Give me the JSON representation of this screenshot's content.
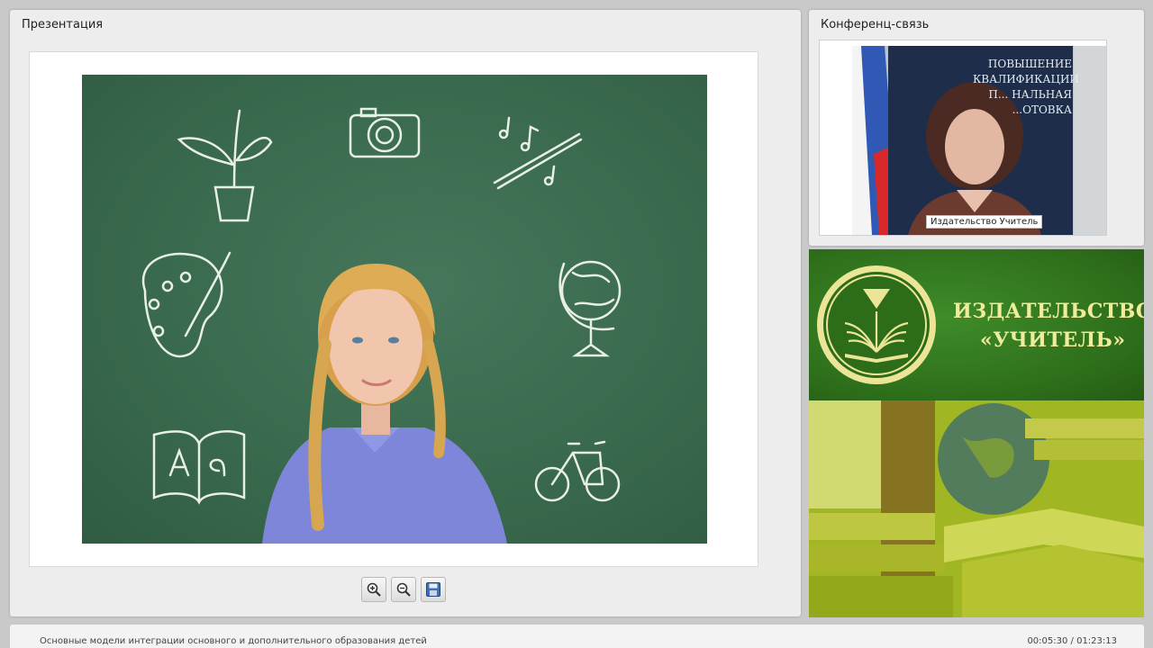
{
  "presentation": {
    "title": "Презентация"
  },
  "toolbar": [
    {
      "name": "zoom-in",
      "icon": "zoom-in-icon"
    },
    {
      "name": "zoom-out",
      "icon": "zoom-out-icon"
    },
    {
      "name": "save",
      "icon": "save-icon"
    }
  ],
  "conference": {
    "title": "Конференц-связь",
    "speaker": "Издательство Учитель"
  },
  "video_backdrop": {
    "line1": "ПОВЫШЕНИЕ",
    "line2": "КВАЛИФИКАЦИИ",
    "line3": "П... НАЛЬНАЯ",
    "line4": "...ОТОВКА"
  },
  "brand": {
    "line1": "ИЗДАТЕЛЬСТВО",
    "line2": "«УЧИТЕЛЬ»"
  },
  "footer": {
    "title": "Основные модели интеграции  основного и дополнительного образования детей",
    "time": "00:05:30 / 01:23:13"
  },
  "colors": {
    "chalkboard": "#3a6a4d",
    "brand_green": "#2d6d1a",
    "brand_gold": "#f1ec9b"
  }
}
